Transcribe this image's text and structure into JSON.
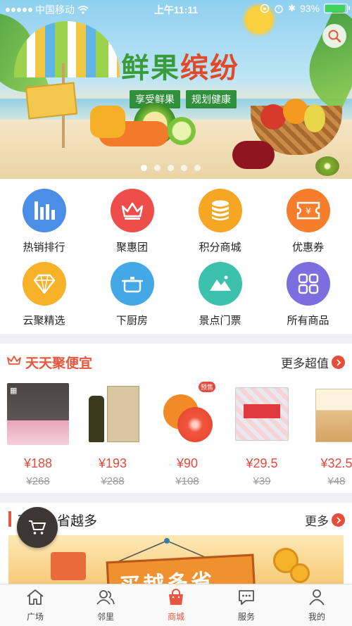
{
  "status_bar": {
    "carrier": "中国移动",
    "time": "上午11:11",
    "battery": "93%",
    "battery_level": 0.93
  },
  "banner": {
    "title_part1": "鲜果",
    "title_part2": "缤纷",
    "tag1": "享受鲜果",
    "tag2": "规划健康",
    "page_count": 5,
    "active_page": 0
  },
  "categories": [
    {
      "label": "热销排行",
      "icon": "bar-chart-icon",
      "color": "#4a8ee8"
    },
    {
      "label": "聚惠团",
      "icon": "crown-icon",
      "color": "#ee4d4a"
    },
    {
      "label": "积分商城",
      "icon": "coin-stack-icon",
      "color": "#f6a623"
    },
    {
      "label": "优惠券",
      "icon": "coupon-icon",
      "color": "#f57d2b"
    },
    {
      "label": "云聚精选",
      "icon": "diamond-icon",
      "color": "#f7b22a"
    },
    {
      "label": "下厨房",
      "icon": "pot-icon",
      "color": "#43a9e6"
    },
    {
      "label": "景点门票",
      "icon": "mountain-icon",
      "color": "#3cc1ad"
    },
    {
      "label": "所有商品",
      "icon": "grid-icon",
      "color": "#7b6fe0"
    }
  ],
  "deals": {
    "title": "天天聚便宜",
    "more": "更多超值",
    "products": [
      {
        "price": "¥188",
        "orig": "¥268",
        "icon": "flower-box-icon"
      },
      {
        "price": "¥193",
        "orig": "¥288",
        "icon": "oil-bottle-icon"
      },
      {
        "price": "¥90",
        "orig": "¥108",
        "icon": "grapefruit-icon",
        "badge": "预售"
      },
      {
        "price": "¥29.5",
        "orig": "¥39",
        "icon": "candy-bag-icon"
      },
      {
        "price": "¥32.5",
        "orig": "¥48",
        "icon": "cereal-box-icon"
      }
    ]
  },
  "buy_more": {
    "title": "买越多省越多",
    "more": "更多",
    "banner_text": "买越多省"
  },
  "tabs": [
    {
      "label": "广场",
      "icon": "home-icon"
    },
    {
      "label": "邻里",
      "icon": "people-icon"
    },
    {
      "label": "商城",
      "icon": "shopping-bag-icon",
      "active": true
    },
    {
      "label": "服务",
      "icon": "chat-bubble-icon"
    },
    {
      "label": "我的",
      "icon": "person-icon"
    }
  ],
  "colors": {
    "accent": "#e8553c",
    "price": "#e34b3c"
  }
}
